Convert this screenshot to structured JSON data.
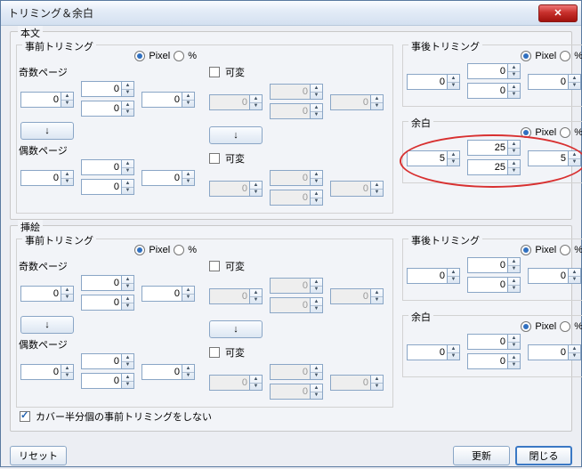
{
  "window": {
    "title": "トリミング＆余白"
  },
  "labels": {
    "body": "本文",
    "illust": "挿絵",
    "pre": "事前トリミング",
    "post": "事後トリミング",
    "margin": "余白",
    "odd": "奇数ページ",
    "even": "偶数ページ",
    "pixel": "Pixel",
    "percent": "%",
    "variable": "可変",
    "arrow": "↓",
    "cover_skip": "カバー半分個の事前トリミングをしない",
    "reset": "リセット",
    "update": "更新",
    "close": "閉じる"
  },
  "body": {
    "pre": {
      "unit": "pixel",
      "odd": {
        "t": 0,
        "b": 0,
        "l": 0,
        "r": 0
      },
      "even": {
        "t": 0,
        "b": 0,
        "l": 0,
        "r": 0
      },
      "var1": {
        "on": false,
        "t": 0,
        "b": 0,
        "l": 0,
        "r": 0
      },
      "var2": {
        "on": false,
        "t": 0,
        "b": 0,
        "l": 0,
        "r": 0
      }
    },
    "post": {
      "unit": "pixel",
      "t": 0,
      "b": 0,
      "l": 0,
      "r": 0
    },
    "margin": {
      "unit": "pixel",
      "t": 25,
      "b": 25,
      "l": 5,
      "r": 5
    }
  },
  "illust": {
    "pre": {
      "unit": "pixel",
      "odd": {
        "t": 0,
        "b": 0,
        "l": 0,
        "r": 0
      },
      "even": {
        "t": 0,
        "b": 0,
        "l": 0,
        "r": 0
      },
      "var1": {
        "on": false,
        "t": 0,
        "b": 0,
        "l": 0,
        "r": 0
      },
      "var2": {
        "on": false,
        "t": 0,
        "b": 0,
        "l": 0,
        "r": 0
      }
    },
    "post": {
      "unit": "pixel",
      "t": 0,
      "b": 0,
      "l": 0,
      "r": 0
    },
    "margin": {
      "unit": "pixel",
      "t": 0,
      "b": 0,
      "l": 0,
      "r": 0
    }
  },
  "cover_skip": true
}
